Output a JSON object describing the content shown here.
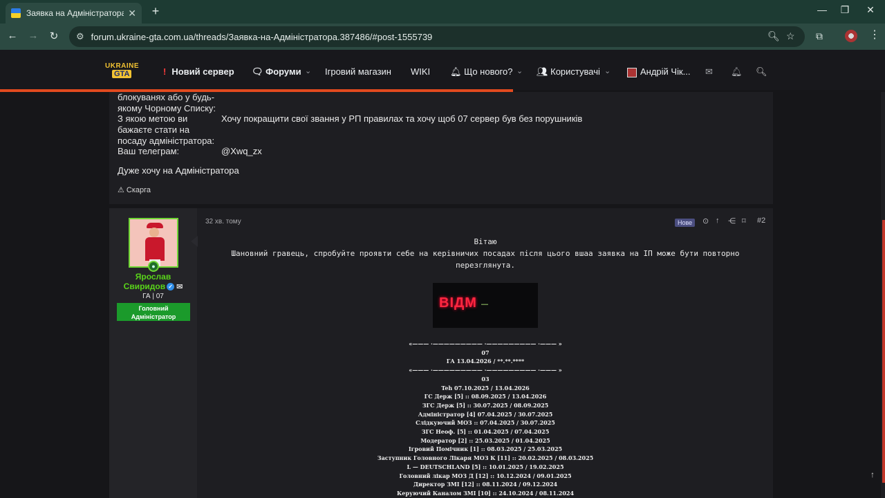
{
  "browser": {
    "tab_title": "Заявка на Адміністратора | UK",
    "tab_close": "✕",
    "new_tab": "+",
    "url": "forum.ukraine-gta.com.ua/threads/Заявка-на-Адміністратора.387486/#post-1555739",
    "win_min": "—",
    "win_restore": "❐",
    "win_close": "✕"
  },
  "forum_nav": {
    "logo_top": "UKRAINE",
    "logo_bottom": "GTA",
    "new_server": "Новий сервер",
    "new_server_mark": "!",
    "forums": "Форуми",
    "shop": "Ігровий магазин",
    "wiki": "WIKI",
    "whats_new": "Що нового?",
    "users": "Користувачі",
    "account": "Андрій Чік..."
  },
  "post1": {
    "lines_partial": [
      "блокуванях або у будь-",
      "якому Чорному Списку:"
    ],
    "goal_label": [
      "З якою метою ви",
      "бажаєте стати на",
      "посаду адміністратора:"
    ],
    "goal_value": "Хочу покращити свої звання у РП правилах та хочу щоб 07 сервер був без порушників",
    "telegram_label": "Ваш телеграм:",
    "telegram_value": "@Xwq_zx",
    "closing": "Дуже хочу на Адміністратора",
    "report": "Скарга"
  },
  "post2": {
    "user_first": "Ярослав",
    "user_last": "Свиридов",
    "user_title": "ГА | 07",
    "user_role_1": "Головний",
    "user_role_2": "Адміністратор",
    "time": "32 хв. тому",
    "new_tag": "Нове",
    "post_number": "#2",
    "greeting": "Вітаю",
    "message_1": "Шановний гравець, спробуйте проявти себе на керівничих посадах після цього вшаа заявка на ІП може бути повторно",
    "message_2": "перезглянута.",
    "gif_text": "ВІДМ",
    "sig_sep": "«——— ·————————— ·————————— ·——— »",
    "sig_server_1": "07",
    "sig_line_1": "ГА 13.04.2026 / **.**.****",
    "sig_server_2": "03",
    "sig_history": [
      "Teh 07.10.2025 / 13.04.2026",
      "ГС Держ [5] :: 08.09.2025 / 13.04.2026",
      "ЗГС Держ [5] :: 30.07.2025 / 08.09.2025",
      "Адміністратор [4] 07.04.2025 / 30.07.2025",
      "Слідкуючий МОЗ :: 07.04.2025 / 30.07.2025",
      "ЗГС Неоф. [5] :: 01.04.2025 / 07.04.2025",
      "Модератор [2] :: 25.03.2025 / 01.04.2025",
      "Ігровий Помічник [1] :: 08.03.2025 / 25.03.2025",
      "Заступник Головного Лікаря МОЗ К [11] :: 20.02.2025 / 08.03.2025",
      "L — DEUTSCHLAND [5] :: 10.01.2025 / 19.02.2025",
      "Головний лікар МОЗ Д [12] :: 10.12.2024 / 09.01.2025",
      "Директор ЗМІ [12] :: 08.11.2024 / 09.12.2024",
      "Керуючий Каналом ЗМІ [10] :: 24.10.2024 / 08.11.2024"
    ]
  },
  "colors": {
    "accent": "#e24a1f",
    "username": "#59d41a",
    "role_badge": "#1b9a2b",
    "browser_bg": "#2c4a42"
  }
}
